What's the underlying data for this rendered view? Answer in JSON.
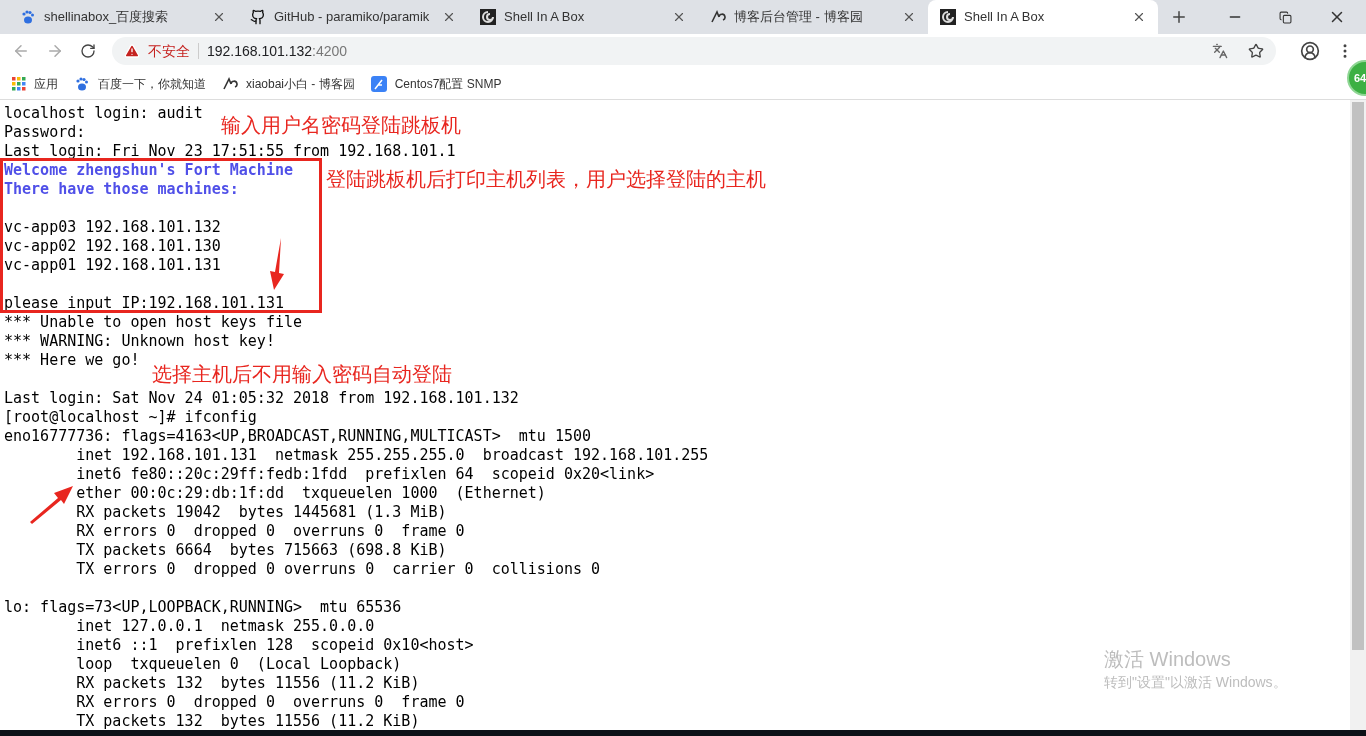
{
  "tabs": [
    {
      "title": "shellinabox_百度搜索",
      "selected": false
    },
    {
      "title": "GitHub - paramiko/paramik",
      "selected": false
    },
    {
      "title": "Shell In A Box",
      "selected": false
    },
    {
      "title": "博客后台管理 - 博客园",
      "selected": false
    },
    {
      "title": "Shell In A Box",
      "selected": true
    }
  ],
  "address_bar": {
    "security": "不安全",
    "host": "192.168.101.132",
    "port": ":4200"
  },
  "bookmarks": [
    {
      "label": "应用"
    },
    {
      "label": "百度一下，你就知道"
    },
    {
      "label": "xiaobai小白 - 博客园"
    },
    {
      "label": "Centos7配置 SNMP"
    }
  ],
  "extension_badge": "64",
  "terminal": {
    "lines": [
      {
        "kind": "normal",
        "text": "localhost login: audit"
      },
      {
        "kind": "normal",
        "text": "Password:"
      },
      {
        "kind": "normal",
        "text": "Last login: Fri Nov 23 17:51:55 from 192.168.101.1"
      },
      {
        "kind": "highlight",
        "text": "Welcome zhengshun's Fort Machine"
      },
      {
        "kind": "highlight",
        "text": "There have those machines:"
      },
      {
        "kind": "blank"
      },
      {
        "kind": "normal",
        "text": "vc-app03 192.168.101.132"
      },
      {
        "kind": "normal",
        "text": "vc-app02 192.168.101.130"
      },
      {
        "kind": "normal",
        "text": "vc-app01 192.168.101.131"
      },
      {
        "kind": "blank"
      },
      {
        "kind": "normal",
        "text": "please input IP:192.168.101.131"
      },
      {
        "kind": "normal",
        "text": "*** Unable to open host keys file"
      },
      {
        "kind": "normal",
        "text": "*** WARNING: Unknown host key!"
      },
      {
        "kind": "normal",
        "text": "*** Here we go!"
      },
      {
        "kind": "blank"
      },
      {
        "kind": "normal",
        "text": "Last login: Sat Nov 24 01:05:32 2018 from 192.168.101.132"
      },
      {
        "kind": "normal",
        "text": "[root@localhost ~]# ifconfig"
      },
      {
        "kind": "normal",
        "text": "eno16777736: flags=4163<UP,BROADCAST,RUNNING,MULTICAST>  mtu 1500"
      },
      {
        "kind": "normal",
        "text": "        inet 192.168.101.131  netmask 255.255.255.0  broadcast 192.168.101.255"
      },
      {
        "kind": "normal",
        "text": "        inet6 fe80::20c:29ff:fedb:1fdd  prefixlen 64  scopeid 0x20<link>"
      },
      {
        "kind": "normal",
        "text": "        ether 00:0c:29:db:1f:dd  txqueuelen 1000  (Ethernet)"
      },
      {
        "kind": "normal",
        "text": "        RX packets 19042  bytes 1445681 (1.3 MiB)"
      },
      {
        "kind": "normal",
        "text": "        RX errors 0  dropped 0  overruns 0  frame 0"
      },
      {
        "kind": "normal",
        "text": "        TX packets 6664  bytes 715663 (698.8 KiB)"
      },
      {
        "kind": "normal",
        "text": "        TX errors 0  dropped 0 overruns 0  carrier 0  collisions 0"
      },
      {
        "kind": "blank"
      },
      {
        "kind": "normal",
        "text": "lo: flags=73<UP,LOOPBACK,RUNNING>  mtu 65536"
      },
      {
        "kind": "normal",
        "text": "        inet 127.0.0.1  netmask 255.0.0.0"
      },
      {
        "kind": "normal",
        "text": "        inet6 ::1  prefixlen 128  scopeid 0x10<host>"
      },
      {
        "kind": "normal",
        "text": "        loop  txqueuelen 0  (Local Loopback)"
      },
      {
        "kind": "normal",
        "text": "        RX packets 132  bytes 11556 (11.2 KiB)"
      },
      {
        "kind": "normal",
        "text": "        RX errors 0  dropped 0  overruns 0  frame 0"
      },
      {
        "kind": "normal",
        "text": "        TX packets 132  bytes 11556 (11.2 KiB)"
      }
    ]
  },
  "annotations": [
    "输入用户名密码登陆跳板机",
    "登陆跳板机后打印主机列表，用户选择登陆的主机",
    "选择主机后不用输入密码自动登陆"
  ],
  "activation_notice": {
    "title": "激活 Windows",
    "subtitle": "转到\"设置\"以激活 Windows。"
  }
}
